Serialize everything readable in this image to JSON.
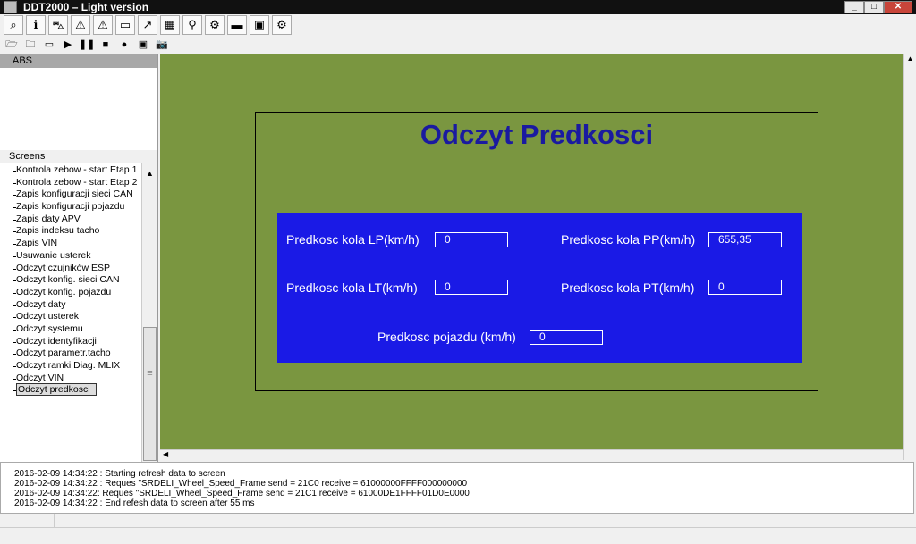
{
  "window": {
    "title": "DDT2000 – Light version",
    "controls": [
      "_",
      "□",
      "✕"
    ]
  },
  "toolbar1": [
    {
      "icon": "binoculars-icon",
      "g": "⌕"
    },
    {
      "icon": "info-icon",
      "g": "ℹ"
    },
    {
      "icon": "car-scan-icon",
      "g": "⛍"
    },
    {
      "icon": "warning-icon",
      "g": "⚠"
    },
    {
      "icon": "can-warning-icon",
      "g": "⚠"
    },
    {
      "icon": "monitor-icon",
      "g": "▭"
    },
    {
      "icon": "chart-icon",
      "g": "↗"
    },
    {
      "icon": "screen-config-icon",
      "g": "▦"
    },
    {
      "icon": "probe-icon",
      "g": "⚲"
    },
    {
      "icon": "engine-icon",
      "g": "⚙"
    },
    {
      "icon": "chip-icon",
      "g": "▬"
    },
    {
      "icon": "window-icon",
      "g": "▣"
    },
    {
      "icon": "gears-icon",
      "g": "⚙"
    }
  ],
  "toolbar2": [
    {
      "icon": "open-folder-icon",
      "g": "🗁"
    },
    {
      "icon": "user-folder-icon",
      "g": "🗀"
    },
    {
      "icon": "folder-window-icon",
      "g": "▭"
    },
    {
      "icon": "play-icon",
      "g": "▶"
    },
    {
      "icon": "pause-icon",
      "g": "❚❚"
    },
    {
      "icon": "stop-icon",
      "g": "■"
    },
    {
      "icon": "record-icon",
      "g": "●"
    },
    {
      "icon": "save-icon",
      "g": "▣"
    },
    {
      "icon": "camera-icon",
      "g": "📷"
    }
  ],
  "left": {
    "ecu_header": "ABS",
    "screens_header": "Screens",
    "screens": [
      "Kontrola zebow - start Etap 1",
      "Kontrola zebow - start Etap 2",
      "Zapis konfiguracji sieci CAN",
      "Zapis konfiguracji pojazdu",
      "Zapis daty APV",
      "Zapis indeksu tacho",
      "Zapis VIN",
      "Usuwanie usterek",
      "Odczyt czujników ESP",
      "Odczyt konfig. sieci CAN",
      "Odczyt konfig. pojazdu",
      "Odczyt daty",
      "Odczyt usterek",
      "Odczyt systemu",
      "Odczyt identyfikacji",
      "Odczyt parametr.tacho",
      "Odczyt ramki Diag. MLIX",
      "Odczyt VIN"
    ],
    "selected": "Odczyt predkosci"
  },
  "screen": {
    "title": "Odczyt Predkosci",
    "colors": {
      "background": "#7a9640",
      "panel": "#1a1ae6",
      "title": "#1a1aa0"
    },
    "lp": {
      "label": "Predkosc kola LP(km/h)",
      "value": "0"
    },
    "pp": {
      "label": "Predkosc kola PP(km/h)",
      "value": "655,35"
    },
    "lt": {
      "label": "Predkosc kola LT(km/h)",
      "value": "0"
    },
    "pt": {
      "label": "Predkosc kola PT(km/h)",
      "value": "0"
    },
    "vehicle": {
      "label": "Predkosc pojazdu (km/h)",
      "value": "0"
    }
  },
  "log": [
    "2016-02-09  14:34:22 : Starting refresh data to screen",
    "2016-02-09  14:34:22 : Reques \"SRDELI_Wheel_Speed_Frame send = 21C0 receive = 61000000FFFF000000000",
    "2016-02-09  14:34:22: Reques \"SRDELI_Wheel_Speed_Frame send = 21C1 receive = 61000DE1FFFF01D0E0000",
    "2016-02-09  14:34:22 : End refesh data to screen after 55 ms"
  ]
}
